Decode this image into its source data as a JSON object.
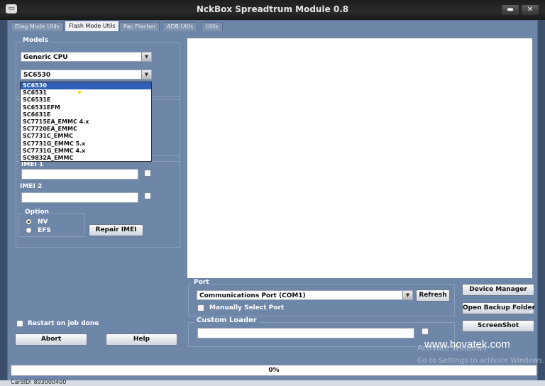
{
  "window": {
    "title": "NckBox Spreadtrum Module 0.8",
    "icon": "app-icon",
    "minimize_glyph": "▬",
    "close_glyph": "✕"
  },
  "tabs": [
    {
      "label": "Diag Mode Utils"
    },
    {
      "label": "Flash Mode Utils",
      "active": true
    },
    {
      "label": "Pac Flasher"
    },
    {
      "label": "ADB Utils"
    },
    {
      "label": "Utils"
    }
  ],
  "models": {
    "legend": "Models",
    "cpu_value": "Generic CPU",
    "model_value": "SC6530",
    "dropdown_options": [
      "SC6530",
      "SC6531",
      "SC6531E",
      "SC6531EFM",
      "SC6631E",
      "SC7715EA_EMMC 4.x",
      "SC7720EA_EMMC",
      "SC7731C_EMMC",
      "SC7731G_EMMC  5.x",
      "SC7731G_EMMC 4.x",
      "SC9832A_EMMC"
    ],
    "selected_option": "SC6530"
  },
  "imei": {
    "imei1_label": "IMEI 1",
    "imei2_label": "IMEI 2",
    "option_legend": "Option",
    "radio_nv": "NV",
    "radio_efs": "EFS",
    "repair_button": "Repair IMEI"
  },
  "left_bottom": {
    "restart_label": "Restart on job done",
    "abort_button": "Abort",
    "help_button": "Help"
  },
  "port": {
    "legend": "Port",
    "value": "Communications Port (COM1)",
    "refresh_button": "Refresh",
    "manual_label": "Manually Select Port"
  },
  "loader": {
    "legend": "Custom Loader"
  },
  "right_buttons": {
    "device_manager": "Device Manager",
    "open_backup": "Open Backup Folder",
    "screenshot": "ScreenShot"
  },
  "progress": {
    "text": "0%",
    "value": 0
  },
  "status": {
    "card_id": "CardID: 893000400"
  },
  "overlay": {
    "watermark": "www.hovatek.com",
    "activate_title": "Activate Windows",
    "activate_sub": "Go to Settings to activate Windows."
  }
}
